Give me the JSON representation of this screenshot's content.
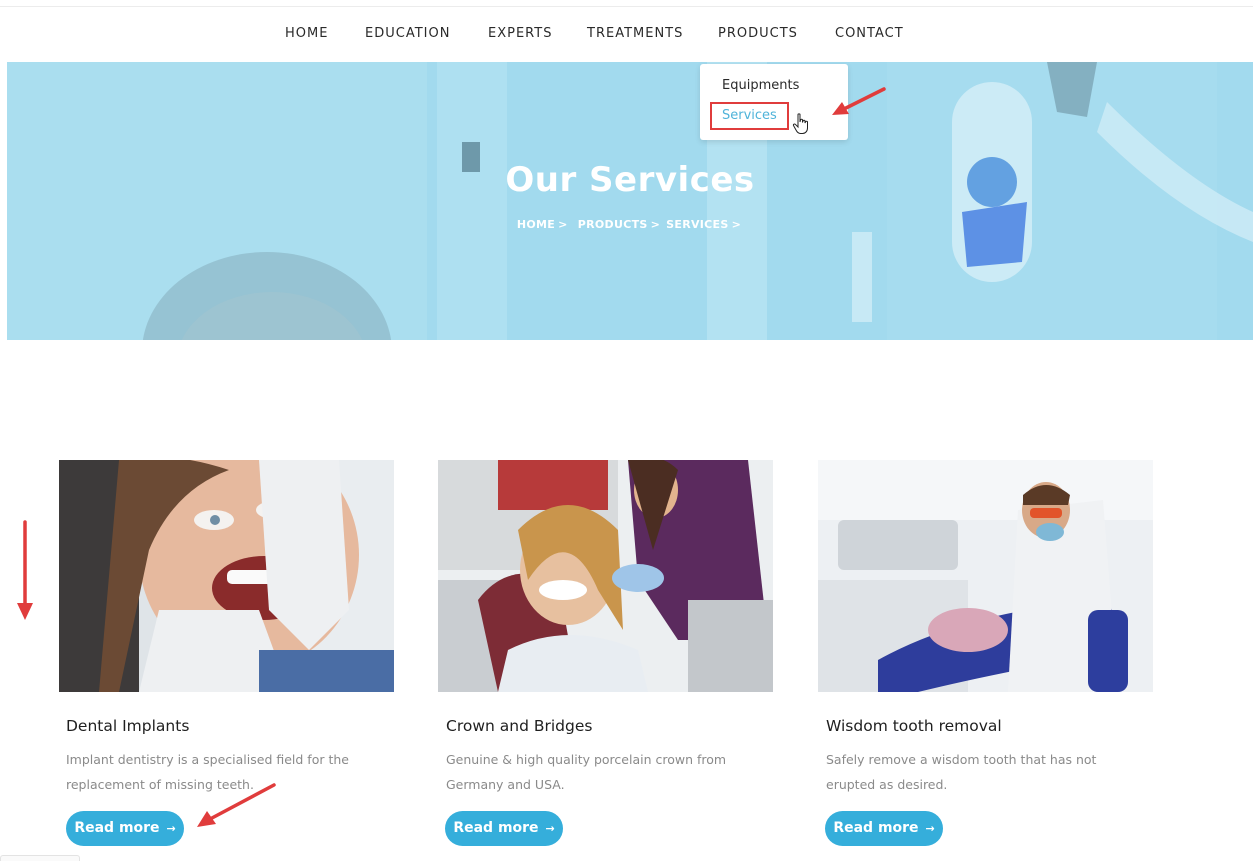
{
  "nav": {
    "items": [
      "HOME",
      "EDUCATION",
      "EXPERTS",
      "TREATMENTS",
      "PRODUCTS",
      "CONTACT"
    ]
  },
  "dropdown": {
    "items": [
      "Equipments",
      "Services"
    ],
    "active": "Services"
  },
  "hero": {
    "title": "Our Services",
    "breadcrumb": [
      "HOME",
      "PRODUCTS",
      "SERVICES"
    ],
    "separator": ">"
  },
  "cards": [
    {
      "title": "Dental Implants",
      "description": "Implant dentistry is a specialised field for the replacement of missing teeth.",
      "button": "Read more",
      "image": "woman-dental-exam-photo"
    },
    {
      "title": "Crown and Bridges",
      "description": "Genuine & high quality porcelain crown from Germany and USA.",
      "button": "Read more",
      "image": "smiling-patient-dentist-chair-photo"
    },
    {
      "title": "Wisdom tooth removal",
      "description": "Safely remove a wisdom tooth that has not erupted as desired.",
      "button": "Read more",
      "image": "dentist-treating-patient-photo"
    }
  ],
  "button_arrow": "→",
  "colors": {
    "accent": "#35aedb",
    "active_link": "#4fb3d9",
    "annotation": "#e03c3c",
    "hero_tint": "#9dd7ea"
  }
}
